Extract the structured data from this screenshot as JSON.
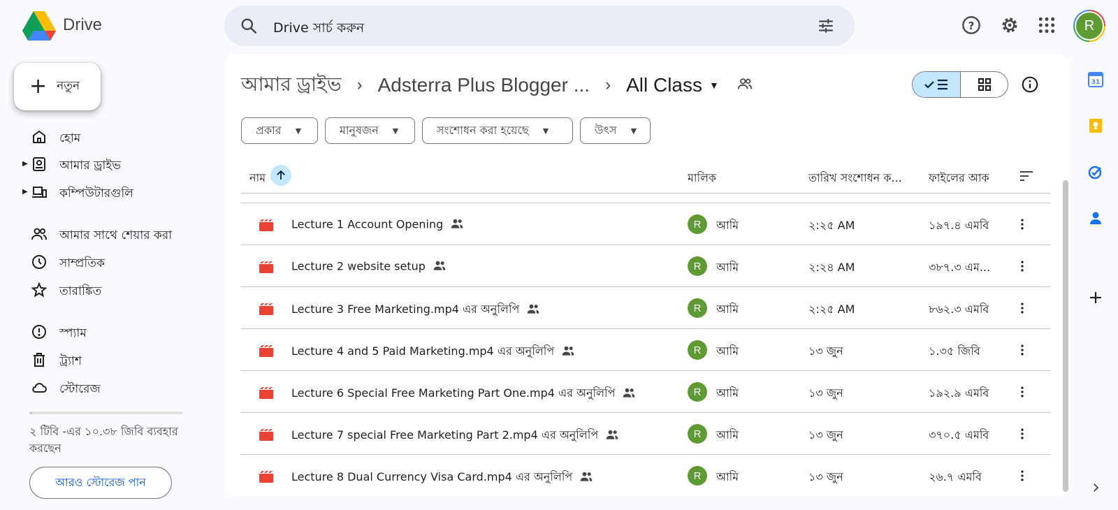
{
  "app": {
    "title": "Drive",
    "search_placeholder": "Drive সার্চ করুন",
    "avatar_letter": "R",
    "accent_color": "#0b57d0",
    "avatar_color": "#5e9b35"
  },
  "sidebar": {
    "new_label": "নতুন",
    "items": [
      {
        "label": "হোম",
        "icon": "home-icon"
      },
      {
        "label": "আমার ড্রাইভ",
        "icon": "my-drive-icon"
      },
      {
        "label": "কম্পিউটারগুলি",
        "icon": "computers-icon"
      },
      {
        "label": "আমার সাথে শেয়ার করা",
        "icon": "shared-people-icon"
      },
      {
        "label": "সাম্প্রতিক",
        "icon": "clock-icon"
      },
      {
        "label": "তারাঙ্কিত",
        "icon": "star-icon"
      },
      {
        "label": "স্প্যাম",
        "icon": "spam-icon"
      },
      {
        "label": "ট্র্যাশ",
        "icon": "trash-icon"
      },
      {
        "label": "স্টোরেজ",
        "icon": "cloud-icon"
      }
    ],
    "storage_used_fraction": 0.005,
    "storage_text": "২ টিবি -এর ১০.৩৮ জিবি ব্যবহার করছেন",
    "storage_button": "আরও স্টোরেজ পান"
  },
  "breadcrumb": {
    "items": [
      "আমার ড্রাইভ",
      "Adsterra Plus Blogger ...",
      "All Class"
    ]
  },
  "filters": [
    "প্রকার",
    "মানুষজন",
    "সংশোধন করা হয়েছে",
    "উৎস"
  ],
  "table": {
    "headers": {
      "name": "নাম",
      "owner": "মালিক",
      "modified": "তারিখ সংশোধন ক...",
      "size": "ফাইলের আক"
    },
    "rows": [
      {
        "name": "Lecture 1 Account Opening",
        "owner": "আমি",
        "modified": "২:২৫ AM",
        "size": "১৯৭.৪ এমবি"
      },
      {
        "name": "Lecture 2 website setup",
        "owner": "আমি",
        "modified": "২:২৪ AM",
        "size": "৩৮৭.৩ এম..."
      },
      {
        "name": "Lecture 3 Free Marketing.mp4 এর অনুলিপি",
        "owner": "আমি",
        "modified": "২:২৫ AM",
        "size": "৮৬২.৩ এমবি"
      },
      {
        "name": "Lecture 4 and 5 Paid Marketing.mp4 এর অনুলিপি",
        "owner": "আমি",
        "modified": "১৩ জুন",
        "size": "১.৩৫ জিবি"
      },
      {
        "name": "Lecture 6 Special Free Marketing Part One.mp4 এর অনুলিপি",
        "owner": "আমি",
        "modified": "১৩ জুন",
        "size": "১৯২.৯ এমবি"
      },
      {
        "name": "Lecture 7 special Free Marketing Part 2.mp4 এর অনুলিপি",
        "owner": "আমি",
        "modified": "১৩ জুন",
        "size": "৩৭০.৫ এমবি"
      },
      {
        "name": "Lecture 8 Dual Currency Visa Card.mp4 এর অনুলিপি",
        "owner": "আমি",
        "modified": "১৩ জুন",
        "size": "২৬.৭ এমবি"
      }
    ]
  },
  "side_panel": [
    "calendar-icon",
    "keep-icon",
    "tasks-icon",
    "contacts-icon",
    "add-icon",
    "expand-icon"
  ]
}
